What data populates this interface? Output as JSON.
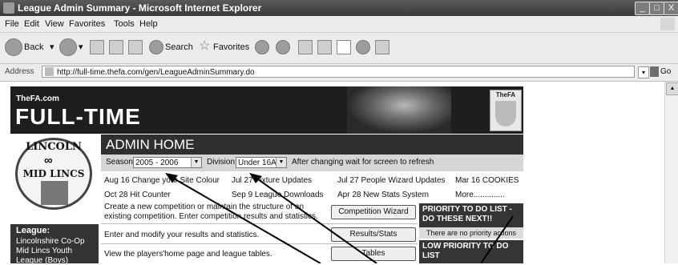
{
  "window": {
    "title": "League Admin Summary - Microsoft Internet Explorer",
    "controls": [
      "_",
      "□",
      "X"
    ]
  },
  "menu": [
    "File",
    "Edit",
    "View",
    "Favorites",
    "Tools",
    "Help"
  ],
  "toolbar": {
    "back": "Back",
    "search": "Search",
    "favorites": "Favorites"
  },
  "address": {
    "label": "Address",
    "url": "http://full-time.thefa.com/gen/LeagueAdminSummary.do",
    "go": "Go"
  },
  "banner": {
    "small": "TheFA.com",
    "big": "FULL-TIME",
    "badge": "TheFA"
  },
  "logo": {
    "top": "LINCOLN",
    "middle": "MID LINCS"
  },
  "admin": {
    "heading": "ADMIN HOME",
    "season_label": "Season",
    "season_value": "2005 - 2006",
    "division_label": "Division",
    "division_value": "Under 16A",
    "notice": "After changing wait for screen to refresh"
  },
  "news": [
    [
      "Aug 16 Change your Site Colour",
      "Jul 27 Fixture Updates",
      "Jul 27 People Wizard Updates",
      "Mar 16 COOKIES"
    ],
    [
      "Oct 28 Hit Counter",
      "Sep 9 League Downloads",
      "Apr 28 New Stats System",
      "More.............."
    ]
  ],
  "tasks": [
    {
      "desc": "Create a new competition or maintain the structure of an existing competition. Enter competition results and statistics.",
      "button": "Competition Wizard"
    },
    {
      "desc": "Enter and modify your results and statistics.",
      "button": "Results/Stats"
    },
    {
      "desc": "View the players'home page and league tables.",
      "button": "Tables"
    }
  ],
  "league": {
    "heading": "League:",
    "items": [
      "Lincolnshire Co-Op",
      "Mid Lincs Youth",
      "League (Boys)"
    ]
  },
  "priority": {
    "heading": "PRIORITY TO DO LIST - DO THESE NEXT!!",
    "message": "There are no priority actions",
    "low_heading": "LOW PRIORITY TO DO LIST"
  }
}
